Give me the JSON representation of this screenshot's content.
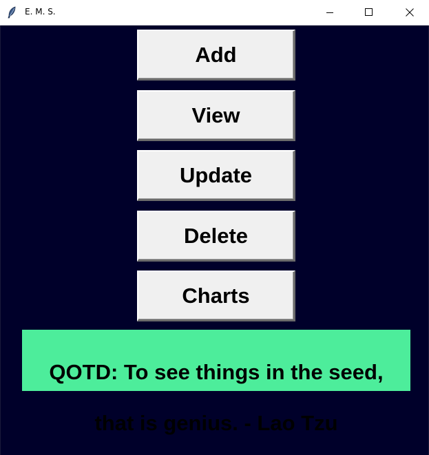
{
  "window": {
    "title": "E. M. S.",
    "icon": "feather-icon",
    "controls": [
      "minimize-icon",
      "maximize-icon",
      "close-icon"
    ]
  },
  "menu": {
    "add_label": "Add",
    "view_label": "View",
    "update_label": "Update",
    "delete_label": "Delete",
    "charts_label": "Charts"
  },
  "quote": {
    "line1": "QOTD:  To see things in the seed,",
    "line2": "that is genius. - Lao Tzu"
  },
  "colors": {
    "background": "#00002a",
    "button_face": "#f0f0f0",
    "quote_background": "#4ded9b"
  }
}
